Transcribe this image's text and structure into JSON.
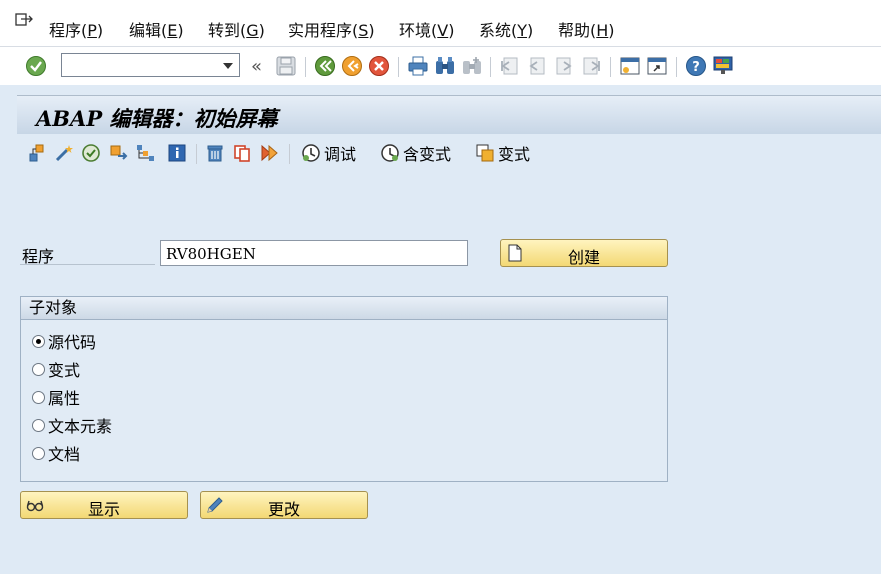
{
  "menu": [
    {
      "label": "程序",
      "accel": "P"
    },
    {
      "label": "编辑",
      "accel": "E"
    },
    {
      "label": "转到",
      "accel": "G"
    },
    {
      "label": "实用程序",
      "accel": "S"
    },
    {
      "label": "环境",
      "accel": "V"
    },
    {
      "label": "系统",
      "accel": "Y"
    },
    {
      "label": "帮助",
      "accel": "H"
    }
  ],
  "command_field": {
    "value": "",
    "placeholder": ""
  },
  "title": "ABAP 编辑器：初始屏幕",
  "app_toolbar": {
    "debug_label": "调试",
    "with_variant_label": "含变式",
    "variant_label": "变式"
  },
  "program": {
    "label": "程序",
    "value": "RV80HGEN"
  },
  "buttons": {
    "create": "创建",
    "display": "显示",
    "change": "更改"
  },
  "subobjects": {
    "title": "子对象",
    "options": [
      {
        "label": "源代码",
        "selected": true
      },
      {
        "label": "变式",
        "selected": false
      },
      {
        "label": "属性",
        "selected": false
      },
      {
        "label": "文本元素",
        "selected": false
      },
      {
        "label": "文档",
        "selected": false
      }
    ]
  }
}
